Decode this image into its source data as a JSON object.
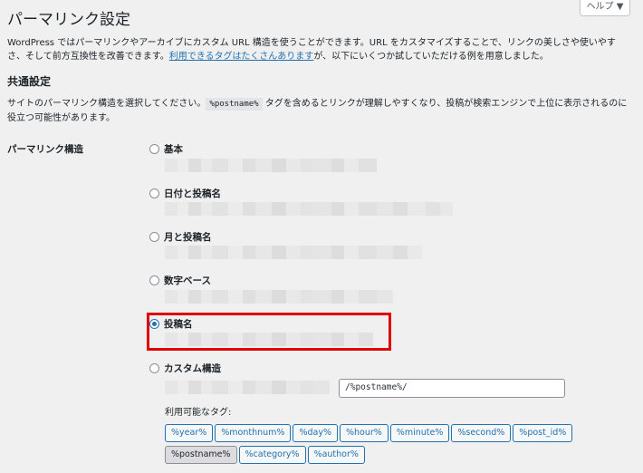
{
  "help": {
    "label": "ヘルプ ▼"
  },
  "page": {
    "title": "パーマリンク設定"
  },
  "intro": {
    "text_before": "WordPress ではパーマリンクやアーカイブにカスタム URL 構造を使うことができます。URL をカスタマイズすることで、リンクの美しさや使いやすさ、そして前方互換性を改善できます。",
    "link_text": "利用できるタグはたくさんあります",
    "text_after": "が、以下にいくつか試していただける例を用意しました。"
  },
  "common": {
    "heading": "共通設定",
    "desc_before": "サイトのパーマリンク構造を選択してください。",
    "desc_code": "%postname%",
    "desc_after": " タグを含めるとリンクが理解しやすくなり、投稿が検索エンジンで上位に表示されるのに役立つ可能性があります。"
  },
  "permalink": {
    "label": "パーマリンク構造",
    "options": [
      {
        "label": "基本",
        "checked": false
      },
      {
        "label": "日付と投稿名",
        "checked": false
      },
      {
        "label": "月と投稿名",
        "checked": false
      },
      {
        "label": "数字ベース",
        "checked": false
      },
      {
        "label": "投稿名",
        "checked": true
      },
      {
        "label": "カスタム構造",
        "checked": false
      }
    ],
    "custom_value": "/%postname%/",
    "tags_label": "利用可能なタグ:",
    "tags": [
      "%year%",
      "%monthnum%",
      "%day%",
      "%hour%",
      "%minute%",
      "%second%",
      "%post_id%",
      "%postname%",
      "%category%",
      "%author%"
    ],
    "active_tag": "%postname%"
  },
  "colors": {
    "accent": "#2271b1",
    "highlight": "#e00000",
    "background": "#f0f0f1"
  }
}
